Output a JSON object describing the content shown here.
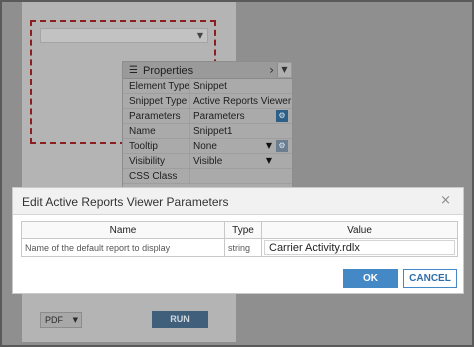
{
  "properties": {
    "title": "Properties",
    "rows": [
      {
        "key": "Element Type",
        "value": "Snippet"
      },
      {
        "key": "Snippet Type",
        "value": "Active Reports Viewer"
      },
      {
        "key": "Parameters",
        "value": "Parameters"
      },
      {
        "key": "Name",
        "value": "Snippet1"
      },
      {
        "key": "Tooltip",
        "value": "None"
      },
      {
        "key": "Visibility",
        "value": "Visible"
      },
      {
        "key": "CSS Class",
        "value": ""
      }
    ]
  },
  "designer": {
    "export_format": "PDF",
    "run_label": "RUN"
  },
  "dialog": {
    "title": "Edit Active Reports Viewer Parameters",
    "close_symbol": "×",
    "columns": [
      "Name",
      "Type",
      "Value"
    ],
    "rows": [
      {
        "name": "Name of the default report to display",
        "type": "string",
        "value": "Carrier Activity.rdlx"
      }
    ],
    "ok_label": "OK",
    "cancel_label": "CANCEL"
  },
  "icons": {
    "properties": "sliders-icon",
    "nav_next": "chevron-right-icon",
    "dropdown": "chevron-down-icon",
    "settings": "gear-icon",
    "close": "close-icon"
  },
  "colors": {
    "primary": "#4488c6",
    "overlay_dim": "#8f8f8f",
    "selection_outline": "#8b1e1e"
  }
}
